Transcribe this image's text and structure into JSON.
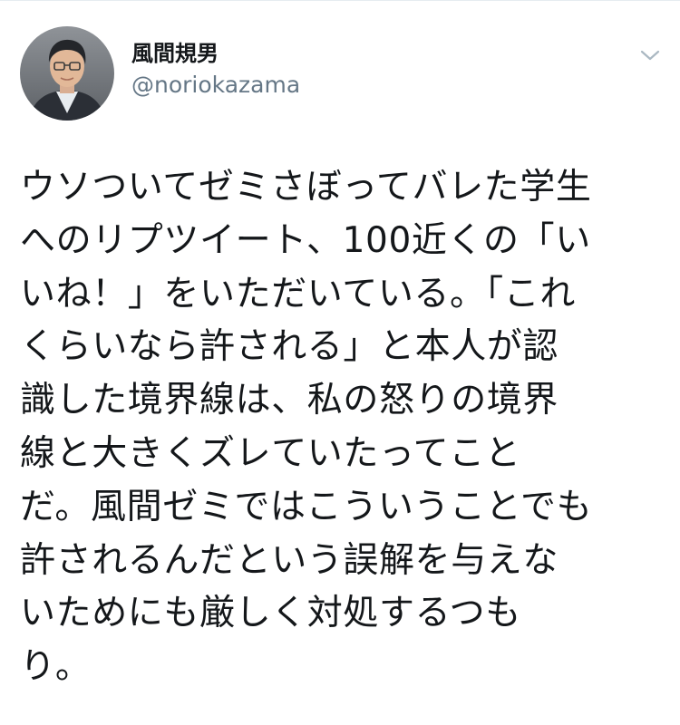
{
  "user": {
    "display_name": "風間規男",
    "screen_name": "@noriokazama",
    "avatar_icon": "profile-photo"
  },
  "menu": {
    "icon": "chevron-down-icon"
  },
  "tweet": {
    "lines": [
      "ウソついてゼミさぼってバレた学生",
      "へのリプツイート、100近くの「い",
      "いね！」をいただいている。「これ",
      "くらいなら許される」と本人が認",
      "識した境界線は、私の怒りの境界",
      "線と大きくズレていたってこと",
      "だ。風間ゼミではこういうことでも",
      "許されるんだという誤解を与えな",
      "いためにも厳しく対処するつも",
      "り。"
    ]
  },
  "colors": {
    "text": "#14171a",
    "secondary": "#657786",
    "caret": "#aab8c2",
    "divider": "#e6ecf0"
  }
}
